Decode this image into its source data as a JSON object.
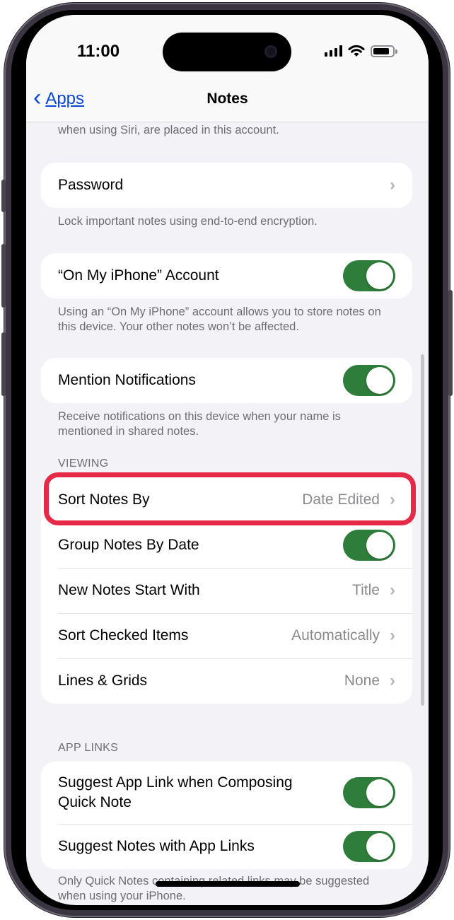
{
  "status_bar": {
    "time": "11:00"
  },
  "nav": {
    "back_label": "Apps",
    "title": "Notes"
  },
  "top_footnote": "when using Siri, are placed in this account.",
  "password": {
    "label": "Password",
    "footnote": "Lock important notes using end-to-end encryption."
  },
  "on_my_iphone": {
    "label": "“On My iPhone” Account",
    "enabled": true,
    "footnote": "Using an “On My iPhone” account allows you to store notes on this device. Your other notes won’t be affected."
  },
  "mentions": {
    "label": "Mention Notifications",
    "enabled": true,
    "footnote": "Receive notifications on this device when your name is mentioned in shared notes."
  },
  "viewing": {
    "header": "VIEWING",
    "sort_notes_by": {
      "label": "Sort Notes By",
      "value": "Date Edited"
    },
    "group_by_date": {
      "label": "Group Notes By Date",
      "enabled": true
    },
    "new_notes_start": {
      "label": "New Notes Start With",
      "value": "Title"
    },
    "sort_checked": {
      "label": "Sort Checked Items",
      "value": "Automatically"
    },
    "lines_grids": {
      "label": "Lines & Grids",
      "value": "None"
    }
  },
  "app_links": {
    "header": "APP LINKS",
    "suggest_composing": {
      "label": "Suggest App Link when Composing Quick Note",
      "enabled": true
    },
    "suggest_notes": {
      "label": "Suggest Notes with App Links",
      "enabled": true
    },
    "footnote": "Only Quick Notes containing related links may be suggested when using your iPhone."
  },
  "colors": {
    "toggle_on": "#2f7d3a",
    "link_blue": "#0a47d6",
    "highlight": "#e42a46"
  }
}
